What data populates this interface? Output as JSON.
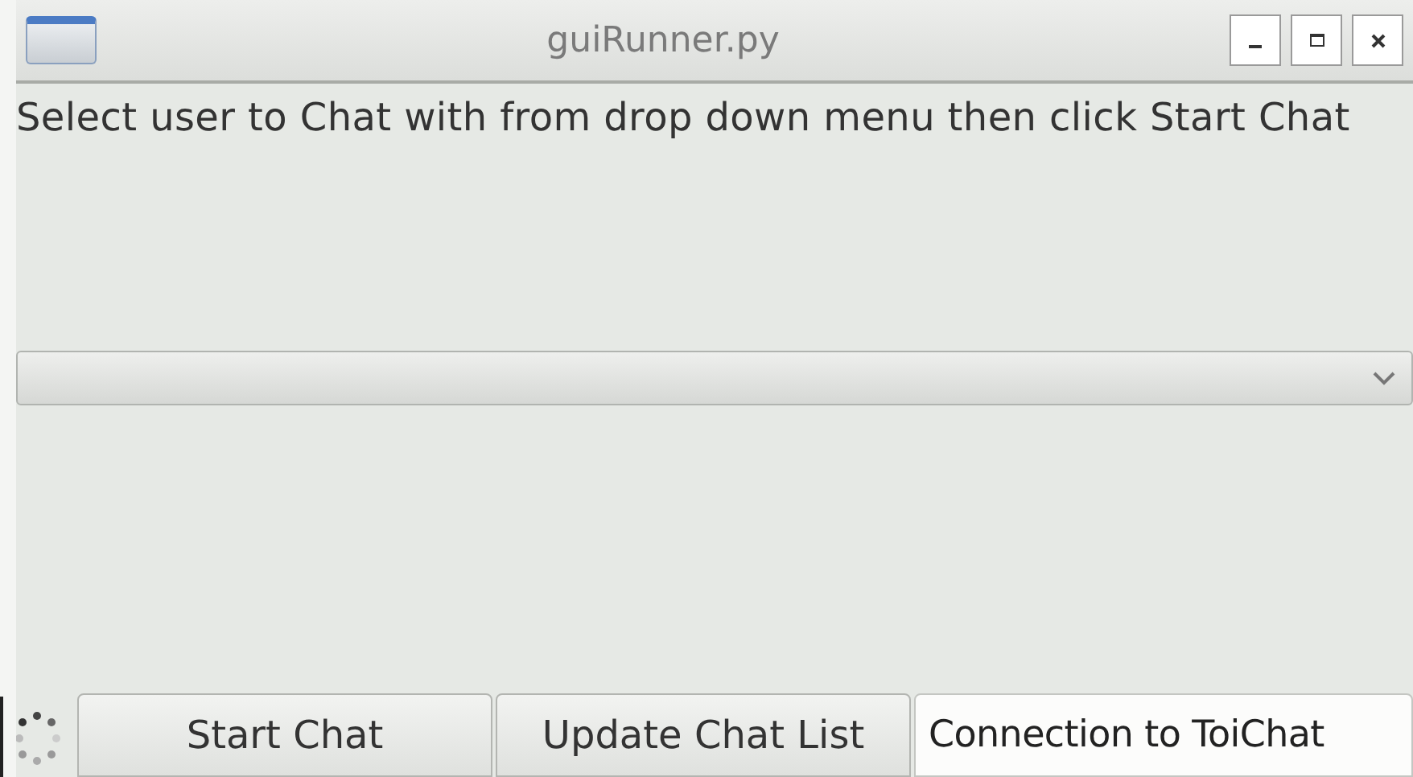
{
  "window": {
    "title": "guiRunner.py"
  },
  "instruction": "Select user to Chat with from drop down menu then click Start Chat",
  "buttons": [
    "Start Chat",
    "Update Chat List"
  ],
  "status": "Connection to ToiChat"
}
